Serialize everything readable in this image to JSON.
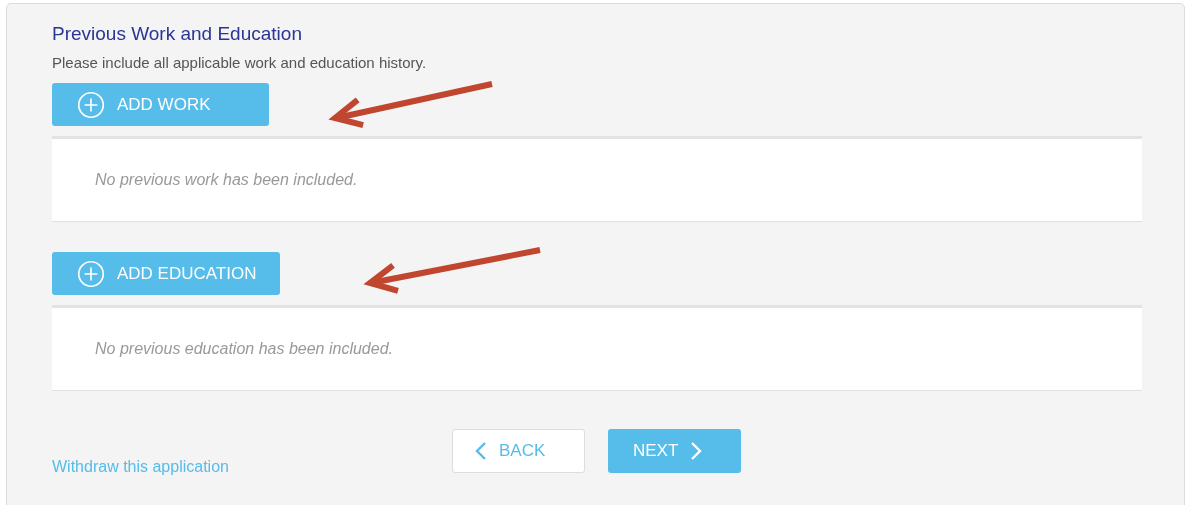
{
  "title": "Previous Work and Education",
  "intro": "Please include all applicable work and education history.",
  "sections": [
    {
      "button": "ADD WORK",
      "empty_message": "No previous work has been included.",
      "annotation_arrow": true
    },
    {
      "button": "ADD EDUCATION",
      "empty_message": "No previous education has been included.",
      "annotation_arrow": true
    }
  ],
  "withdraw_link": "Withdraw this application",
  "back_button": "BACK",
  "next_button": "NEXT"
}
